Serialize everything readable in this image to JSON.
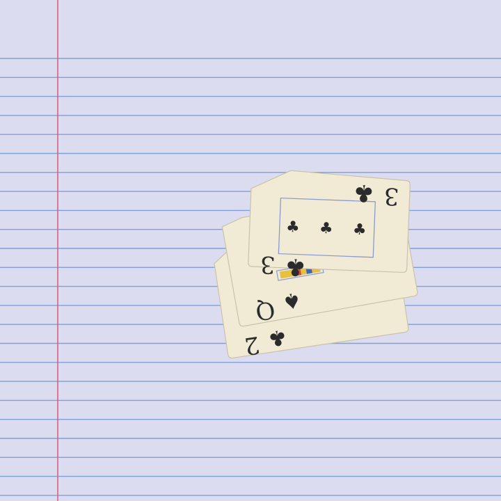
{
  "scene": {
    "paper_color": "#dcdcf0",
    "rule_color": "#7f9fd8",
    "margin_color": "#d8607a",
    "card_face_color": "#f1ebd6",
    "card_edge_color": "#c9c2a8",
    "ink_color": "#2b2b2b",
    "pip_frame_color": "#8a9ad0",
    "courtcard_trim_colors": [
      "#e8c040",
      "#d84838",
      "#3868b8"
    ]
  },
  "cards": [
    {
      "rank": "2",
      "suit": "clubs",
      "suit_symbol": "♣",
      "visibility": "corner-only"
    },
    {
      "rank": "Q",
      "suit": "spades",
      "suit_symbol": "♠",
      "visibility": "corner-only"
    },
    {
      "rank": "3",
      "suit": "clubs",
      "suit_symbol": "♣",
      "visibility": "full-face"
    }
  ],
  "top_card_center_pips": [
    "♣",
    "♣",
    "♣"
  ]
}
